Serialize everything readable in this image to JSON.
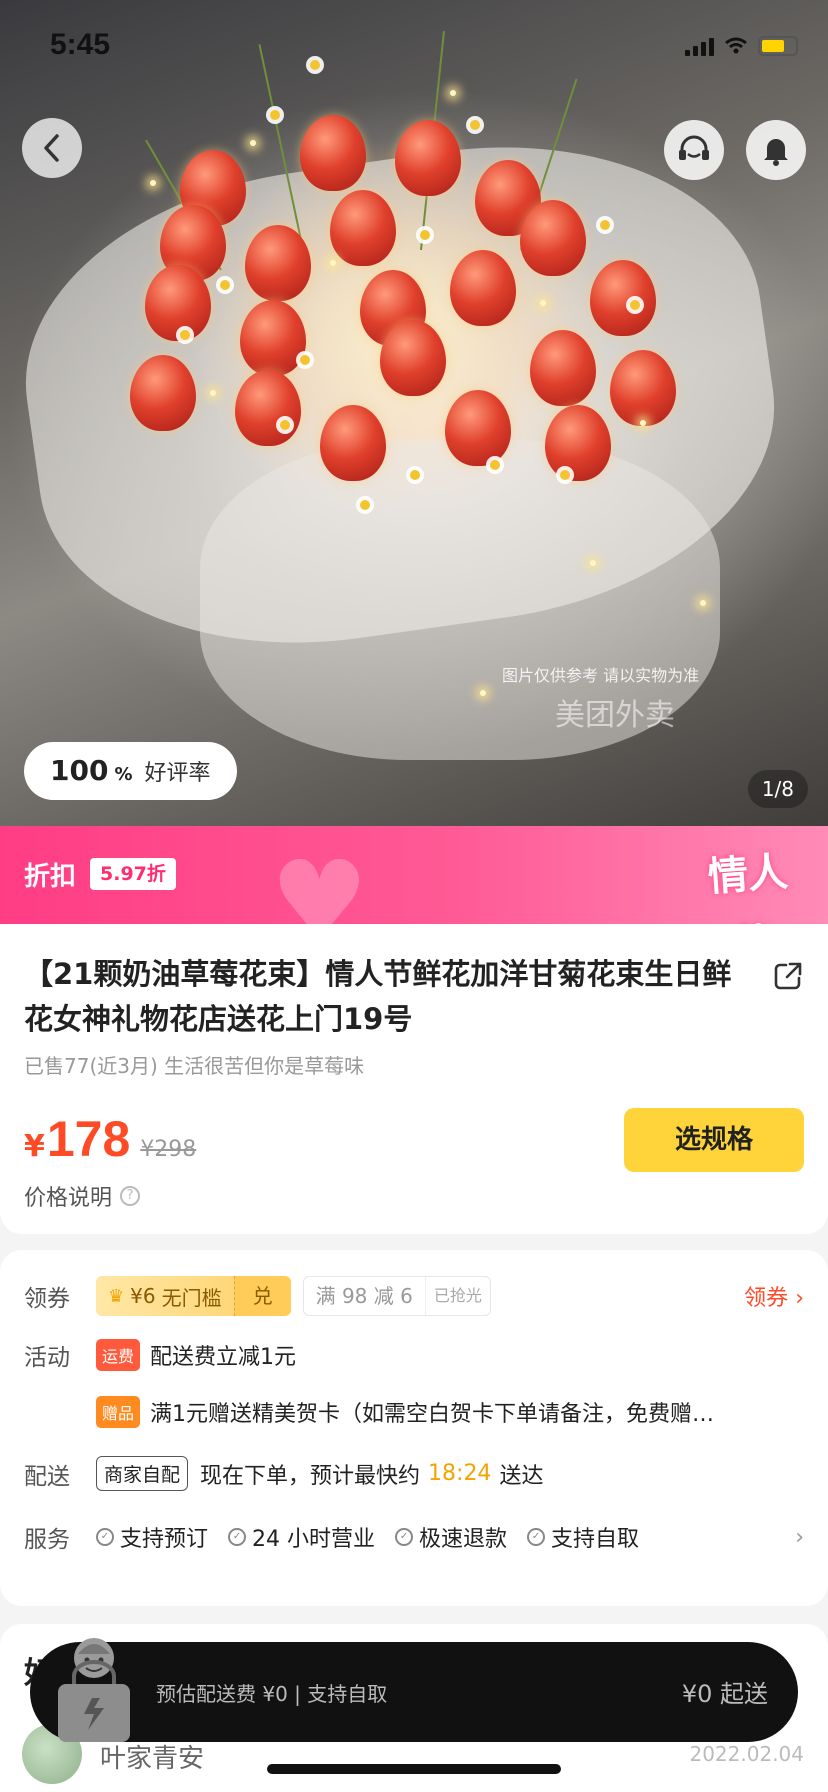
{
  "status_bar": {
    "time": "5:45"
  },
  "hero": {
    "watermark": "美团外卖",
    "note": "图片仅供参考 请以实物为准",
    "rating_value": "100",
    "rating_unit": "%",
    "rating_label": "好评率",
    "image_counter": "1/8"
  },
  "discount": {
    "label": "折扣",
    "value": "5.97折",
    "festival": "情人节"
  },
  "product": {
    "title": "【21颗奶油草莓花束】情人节鲜花加洋甘菊花束生日鲜花女神礼物花店送花上门19号",
    "sold": "已售77(近3月) 生活很苦但你是草莓味",
    "currency": "¥",
    "price": "178",
    "original_price": "¥298",
    "price_note": "价格说明",
    "spec_button": "选规格"
  },
  "info": {
    "coupon": {
      "key": "领券",
      "gold_amount": "¥6",
      "gold_text": "无门槛",
      "gold_action": "兑",
      "grey_text": "满 98 减 6",
      "grey_status": "已抢光",
      "link": "领券"
    },
    "activity": {
      "key": "活动",
      "items": [
        {
          "tag": "运费",
          "text": "配送费立减1元"
        },
        {
          "tag": "赠品",
          "text": "满1元赠送精美贺卡（如需空白贺卡下单请备注，免费赠…"
        }
      ]
    },
    "delivery": {
      "key": "配送",
      "tag": "商家自配",
      "text_before": "现在下单，预计最快约",
      "time": "18:24",
      "text_after": "送达"
    },
    "service": {
      "key": "服务",
      "items": [
        "支持预订",
        "24 小时营业",
        "极速退款",
        "支持自取"
      ]
    }
  },
  "review": {
    "heading": "好",
    "reviewer": "叶家青安",
    "date": "2022.02.04"
  },
  "cart": {
    "info": "预估配送费 ¥0 | 支持自取",
    "min_order": "¥0 起送"
  },
  "colors": {
    "accent_red": "#ff4a26",
    "pink": "#ff3d84",
    "yellow": "#ffd43b"
  }
}
